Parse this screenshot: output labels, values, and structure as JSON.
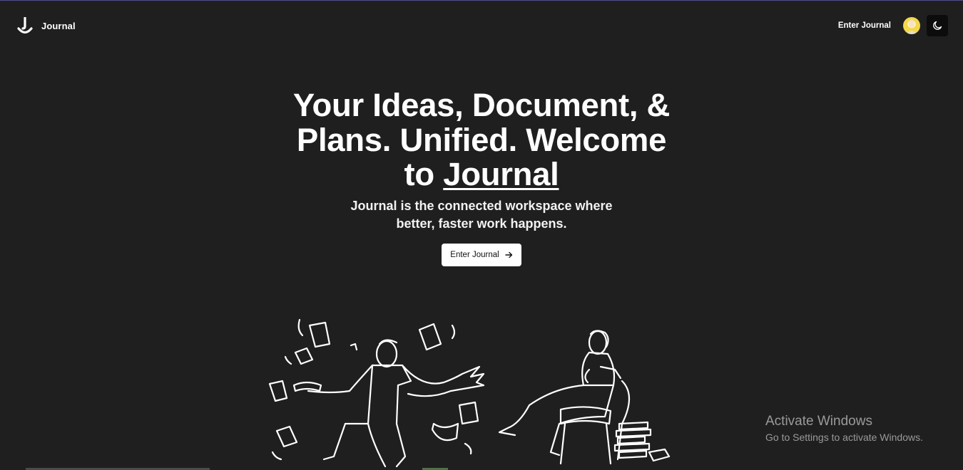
{
  "brand": {
    "name": "Journal",
    "logo_icon": "j-smile-logo-icon"
  },
  "nav": {
    "enter_label": "Enter Journal",
    "avatar_icon": "user-avatar-icon",
    "theme_icon": "moon-icon"
  },
  "hero": {
    "title_line1": "Your Ideas, Document, &",
    "title_line2": "Plans. Unified. Welcome",
    "title_line3_prefix": "to",
    "title_line3_link": "Journal",
    "subtitle_line1": "Journal is the connected workspace where",
    "subtitle_line2": "better, faster work happens.",
    "cta_label": "Enter Journal",
    "cta_icon": "arrow-right-icon"
  },
  "illustration": {
    "icon": "people-with-papers-illustration"
  },
  "watermark": {
    "title": "Activate Windows",
    "subtitle": "Go to Settings to activate Windows."
  },
  "colors": {
    "background": "#1f1f1f",
    "text": "#ffffff",
    "button_bg": "#ffffff",
    "button_text": "#111111"
  }
}
